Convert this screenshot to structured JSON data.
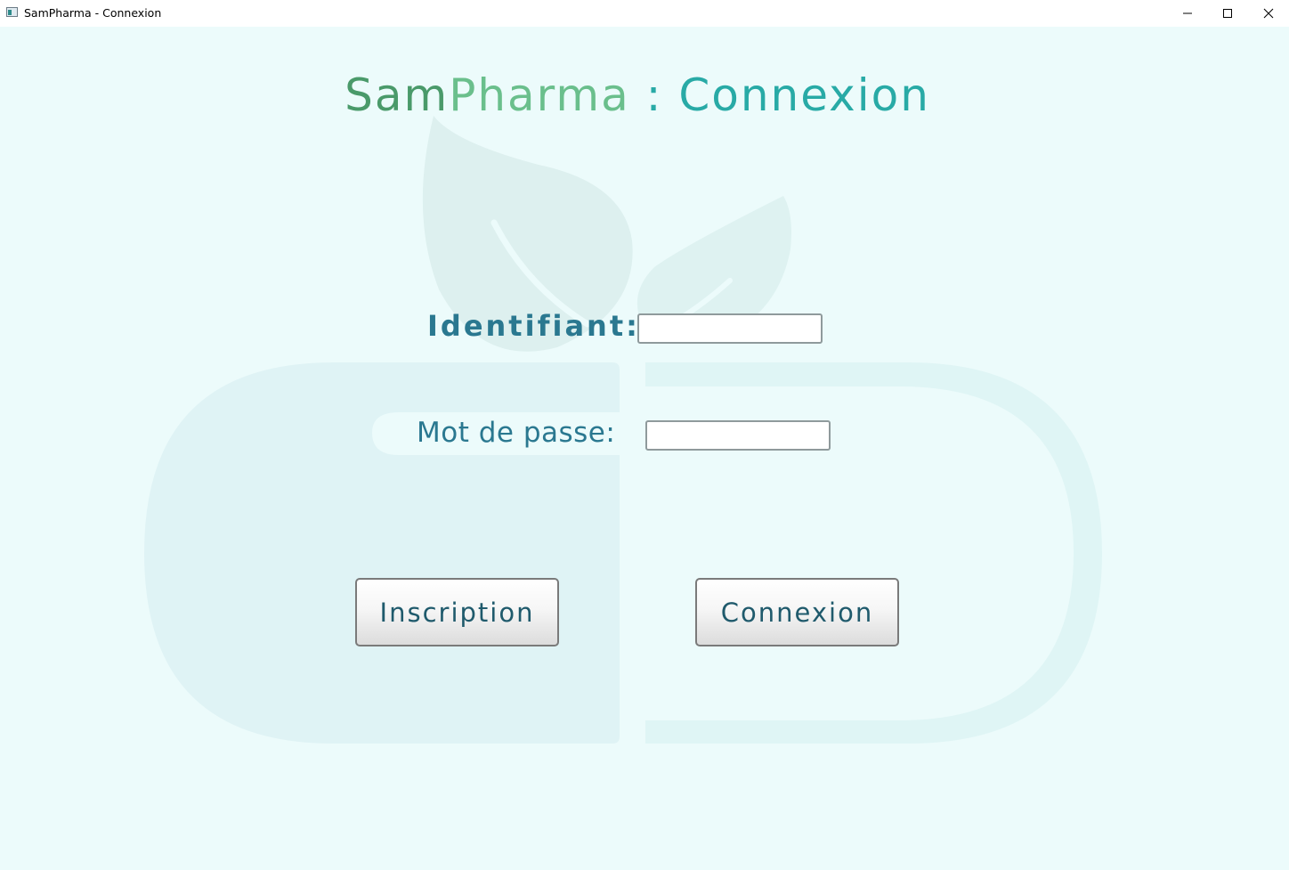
{
  "window": {
    "title": "SamPharma - Connexion",
    "controls": [
      "minimize",
      "maximize",
      "close"
    ]
  },
  "heading": {
    "part_sam": "Sam",
    "part_pharma": "Pharma",
    "part_rest": " : Connexion"
  },
  "form": {
    "identifiant_label": "Identifiant:",
    "identifiant_value": "",
    "password_label": "Mot de passe:",
    "password_value": ""
  },
  "buttons": {
    "inscription": "Inscription",
    "connexion": "Connexion"
  },
  "colors": {
    "background": "#ecfbfb",
    "heading_sam": "#4a9a6a",
    "heading_pharma": "#6abf8c",
    "heading_rest": "#28aaa6",
    "label": "#2a7890",
    "button_text": "#1f5a6c"
  },
  "icons": {
    "app": "app-window-icon",
    "minimize": "minimize-icon",
    "maximize": "maximize-icon",
    "close": "close-icon",
    "background": "leaf-capsule-logo"
  }
}
